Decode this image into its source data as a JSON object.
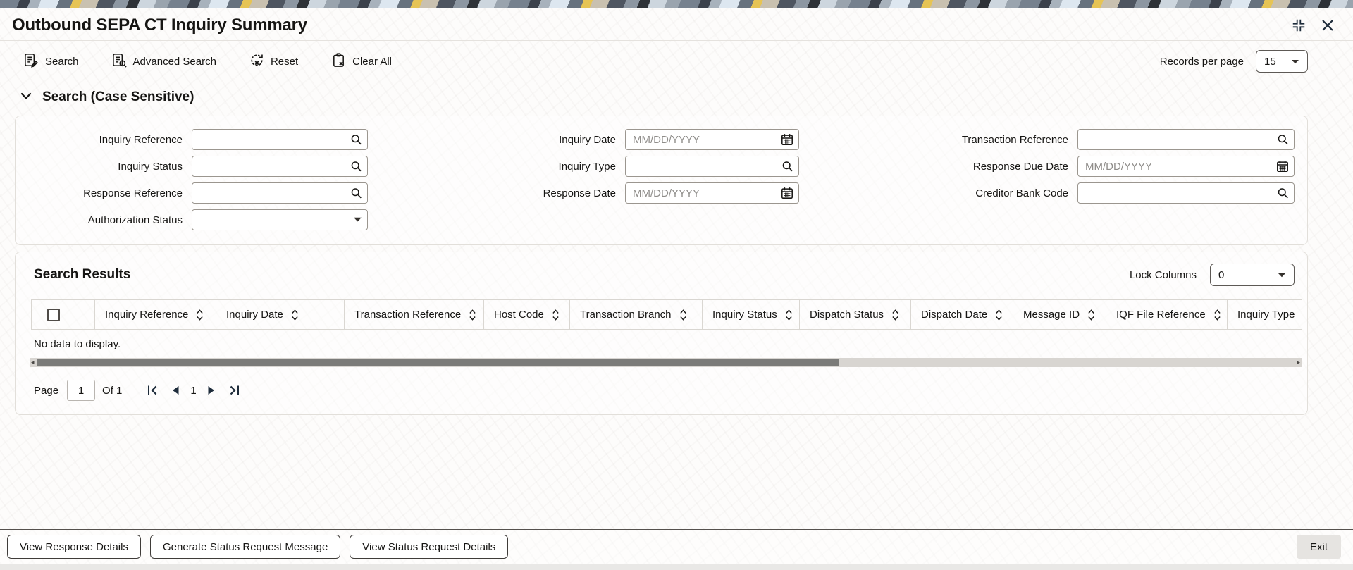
{
  "window": {
    "title": "Outbound SEPA CT Inquiry Summary"
  },
  "toolbar": {
    "search": "Search",
    "advanced_search": "Advanced Search",
    "reset": "Reset",
    "clear_all": "Clear All",
    "records_per_page_label": "Records per page",
    "records_per_page_value": "15"
  },
  "search_section": {
    "title": "Search (Case Sensitive)",
    "col1": [
      {
        "label": "Inquiry Reference"
      },
      {
        "label": "Inquiry Status"
      },
      {
        "label": "Response Reference"
      },
      {
        "label": "Authorization Status"
      }
    ],
    "col2": [
      {
        "label": "Inquiry Date",
        "placeholder": "MM/DD/YYYY"
      },
      {
        "label": "Inquiry Type"
      },
      {
        "label": "Response Date",
        "placeholder": "MM/DD/YYYY"
      }
    ],
    "col3": [
      {
        "label": "Transaction Reference"
      },
      {
        "label": "Response Due Date",
        "placeholder": "MM/DD/YYYY"
      },
      {
        "label": "Creditor Bank Code"
      }
    ]
  },
  "results": {
    "title": "Search Results",
    "lock_columns_label": "Lock Columns",
    "lock_columns_value": "0",
    "columns": [
      "Inquiry Reference",
      "Inquiry Date",
      "Transaction Reference",
      "Host Code",
      "Transaction Branch",
      "Inquiry Status",
      "Dispatch Status",
      "Dispatch Date",
      "Message ID",
      "IQF File Reference",
      "Inquiry Type"
    ],
    "empty_message": "No data to display.",
    "pagination": {
      "page_label": "Page",
      "page_value": "1",
      "of_label": "Of 1",
      "current_page": "1"
    }
  },
  "footer": {
    "buttons": [
      "View Response Details",
      "Generate Status Request Message",
      "View Status Request Details"
    ],
    "exit_label": "Exit"
  },
  "colors": {
    "text": "#161513",
    "icon_navy": "#1d2b3a",
    "camo_gold": "#e6c455",
    "scroll_thumb": "#7b7b79"
  },
  "icons": {
    "window_controls": [
      "collapse-icon",
      "close-icon"
    ],
    "toolbar": [
      "search-form-icon",
      "advanced-search-icon",
      "reset-icon",
      "clear-all-icon"
    ],
    "fields": [
      "magnifier-icon",
      "calendar-icon",
      "dropdown-caret-icon"
    ],
    "table": [
      "sort-icon",
      "checkbox"
    ],
    "pagination": [
      "first-page-icon",
      "previous-page-icon",
      "next-page-icon",
      "last-page-icon"
    ]
  }
}
